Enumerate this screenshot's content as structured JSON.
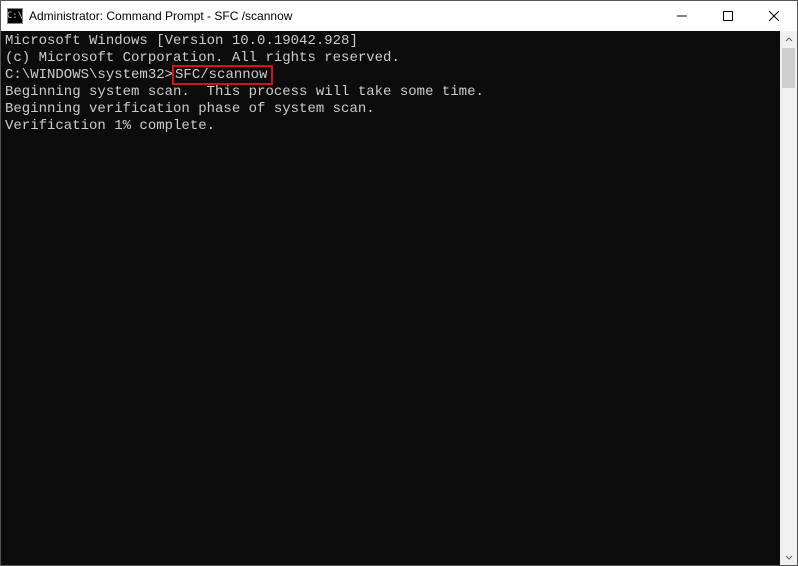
{
  "titlebar": {
    "icon_glyph": "C:\\",
    "title": "Administrator: Command Prompt - SFC /scannow"
  },
  "console": {
    "line1": "Microsoft Windows [Version 10.0.19042.928]",
    "line2": "(c) Microsoft Corporation. All rights reserved.",
    "blank1": "",
    "prompt": "C:\\WINDOWS\\system32>",
    "command": "SFC/scannow",
    "blank2": "",
    "line3": "Beginning system scan.  This process will take some time.",
    "blank3": "",
    "line4": "Beginning verification phase of system scan.",
    "line5": "Verification 1% complete."
  }
}
